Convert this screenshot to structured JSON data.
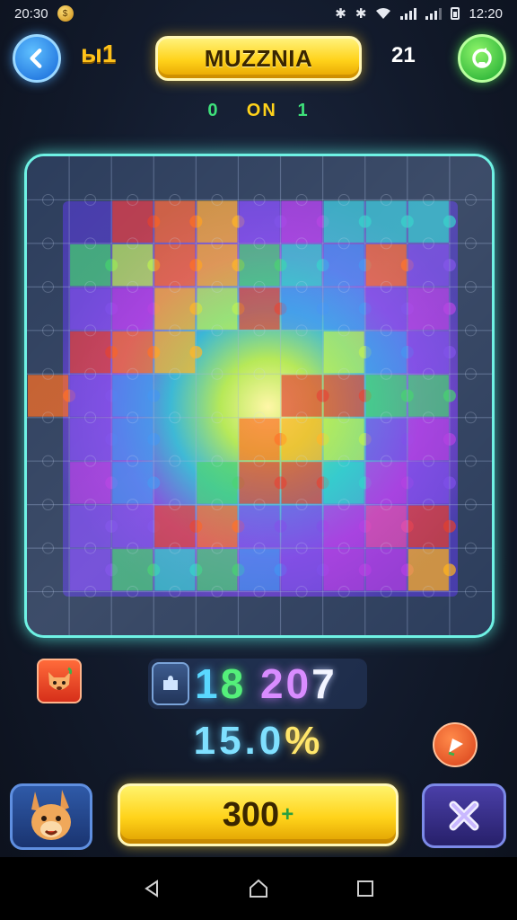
{
  "status_bar": {
    "time_left": "20:30",
    "time_right": "12:20",
    "icons": [
      "coin-icon",
      "bluetooth-icon",
      "vibrate-icon",
      "wifi-icon",
      "signal-icon",
      "signal-icon",
      "battery-icon"
    ]
  },
  "header": {
    "back_icon": "chevron-left-icon",
    "level_label": "ы1",
    "title": "MUZZNIA",
    "moves": "21",
    "right_icon": "refresh-icon"
  },
  "subtitle": {
    "left": "0",
    "middle": "ON",
    "right": "1"
  },
  "board": {
    "columns": 11,
    "rows": 11,
    "accent_color": "#6ff2e4"
  },
  "stats": {
    "fox_badge_icon": "fox-icon",
    "score_icon": "puzzle-piece-icon",
    "score_parts": [
      "1",
      "8",
      "20",
      "7"
    ],
    "percent_parts": [
      "15.0",
      "%"
    ],
    "hint_icon": "flag-icon"
  },
  "actions": {
    "mascot_icon": "kangaroo-mascot-icon",
    "main_label": "300",
    "main_suffix": "+",
    "close_icon": "close-icon"
  },
  "nav": {
    "back": "nav-back-icon",
    "home": "nav-home-icon",
    "recent": "nav-recent-icon"
  },
  "colors": {
    "accent_yellow": "#ffd21a",
    "accent_cyan": "#6ff2e4",
    "accent_green": "#3ee07a",
    "background": "#121a2b"
  }
}
